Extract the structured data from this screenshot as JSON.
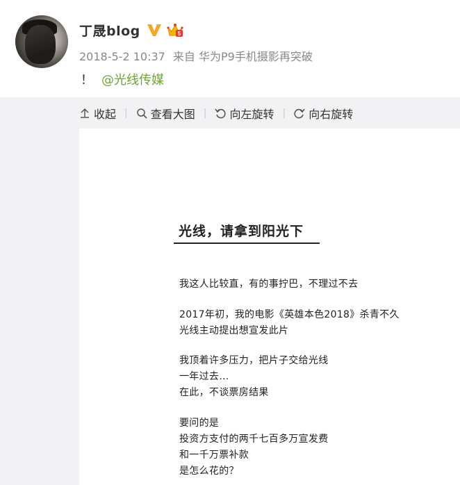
{
  "post": {
    "username": "丁晟blog",
    "date": "2018-5-2 10:37",
    "source_prefix": "来自",
    "source": "华为P9手机摄影再突破",
    "text_prefix": "！",
    "mention": "@光线传媒"
  },
  "toolbar": {
    "collapse": "收起",
    "view_large": "查看大图",
    "rotate_left": "向左旋转",
    "rotate_right": "向右旋转"
  },
  "document": {
    "title": "光线，请拿到阳光下",
    "lines": [
      "我这人比较直，有的事拧巴，不理过不去",
      "2017年初，我的电影《英雄本色2018》杀青不久",
      "光线主动提出想宣发此片",
      "我顶着许多压力，把片子交给光线",
      "一年过去…",
      "在此，不谈票房结果",
      "要问的是",
      "投资方支付的两千七百多万宣发费",
      "和一千万票补款",
      "是怎么花的？"
    ]
  },
  "colors": {
    "mention": "#6aa72f",
    "verified": "#f5a623",
    "gallery_bg": "#f2f2f5",
    "meta_text": "#888888"
  },
  "icons": [
    "verified-icon",
    "crown-icon",
    "collapse-arrow-icon",
    "search-icon",
    "rotate-left-icon",
    "rotate-right-icon"
  ]
}
